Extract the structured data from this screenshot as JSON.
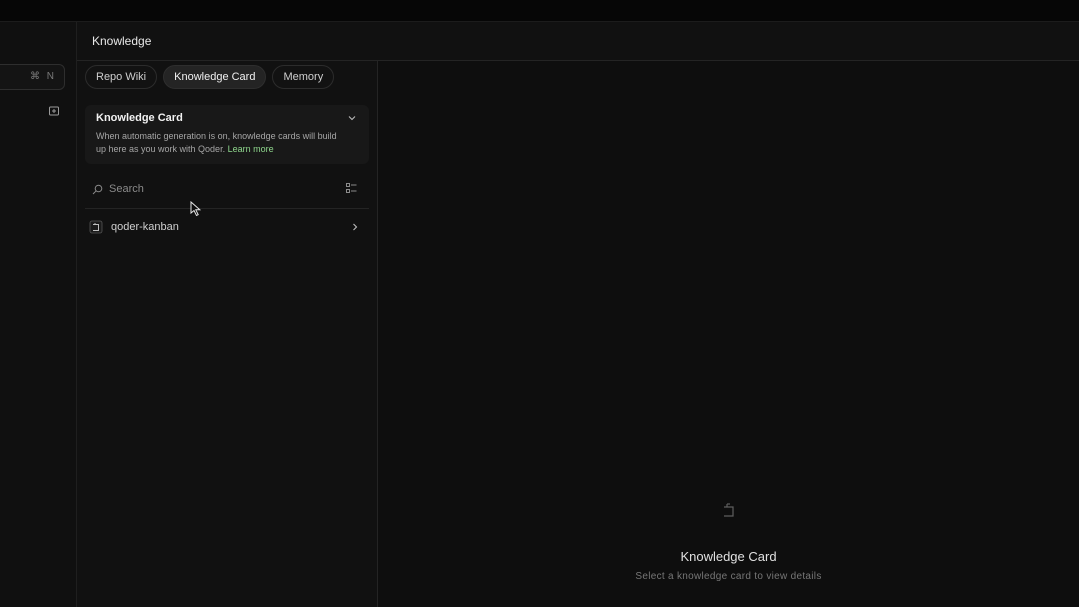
{
  "sidebar": {
    "new_chat_shortcut": "⌘ N",
    "folder_icon": "folder-plus-icon"
  },
  "knowledge": {
    "title": "Knowledge",
    "tabs": [
      {
        "label": "Repo Wiki",
        "active": false
      },
      {
        "label": "Knowledge Card",
        "active": true
      },
      {
        "label": "Memory",
        "active": false
      }
    ],
    "info_card": {
      "title": "Knowledge Card",
      "description": "When automatic generation is on, knowledge cards will build up here as you work with Qoder.",
      "link": "Learn more"
    },
    "search": {
      "placeholder": "Search",
      "value": ""
    },
    "repos": [
      {
        "label": "qoder-kanban"
      }
    ],
    "empty_state": {
      "title": "Knowledge Card",
      "subtitle": "Select a knowledge card to view details"
    }
  },
  "colors": {
    "background": "#0d0d0d",
    "panel": "#111111",
    "accent_link": "#8ed68c",
    "active_tab": "#242424"
  }
}
